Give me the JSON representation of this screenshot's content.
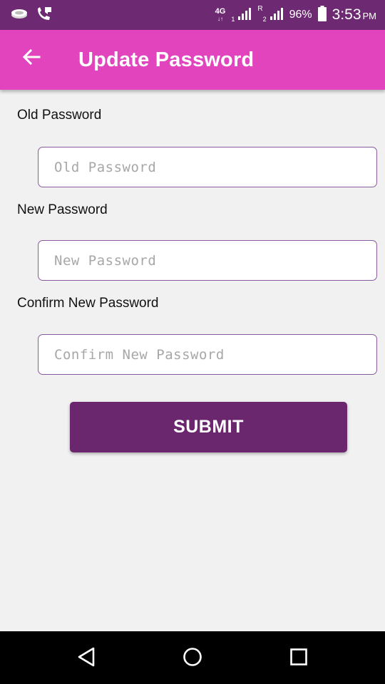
{
  "status_bar": {
    "network_type": "4G",
    "network_arrows": "↓↑",
    "sim1": "1",
    "roaming": "R",
    "sim2": "2",
    "battery": "96%",
    "time": "3:53",
    "ampm": "PM",
    "icons": [
      "sim-card-icon",
      "missed-call-icon",
      "signal-icon",
      "signal-icon",
      "battery-icon"
    ]
  },
  "app_bar": {
    "title": "Update Password",
    "back_icon": "arrow-left-icon",
    "color": "#e244bd"
  },
  "form": {
    "old_password": {
      "label": "Old Password",
      "placeholder": "Old Password",
      "value": ""
    },
    "new_password": {
      "label": "New Password",
      "placeholder": "New Password",
      "value": ""
    },
    "confirm_password": {
      "label": "Confirm New Password",
      "placeholder": "Confirm New Password",
      "value": ""
    },
    "submit_label": "SUBMIT",
    "submit_color": "#6b276e"
  },
  "nav_bar": {
    "icons": [
      "back-triangle-icon",
      "home-circle-icon",
      "recents-square-icon"
    ]
  },
  "colors": {
    "status_bar": "#6d2a72",
    "background": "#f1f1f1",
    "input_border": "#8a5a9e"
  }
}
